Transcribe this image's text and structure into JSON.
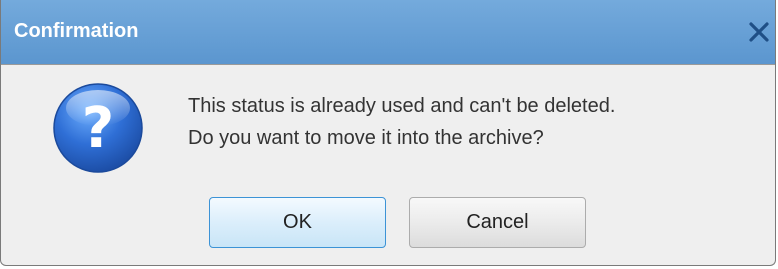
{
  "dialog": {
    "title": "Confirmation",
    "close_icon": "close-icon",
    "icon": "question-icon",
    "icon_glyph": "?",
    "message_line1": "This status is already used and can't be deleted.",
    "message_line2": "Do you want to move it into the archive?",
    "ok_label": "OK",
    "cancel_label": "Cancel"
  },
  "colors": {
    "titlebar": "#5b96cf",
    "title_text": "#ffffff",
    "body_background": "#efefef",
    "ok_border": "#3c93d6",
    "question_icon_blue": "#2f6fd6"
  }
}
